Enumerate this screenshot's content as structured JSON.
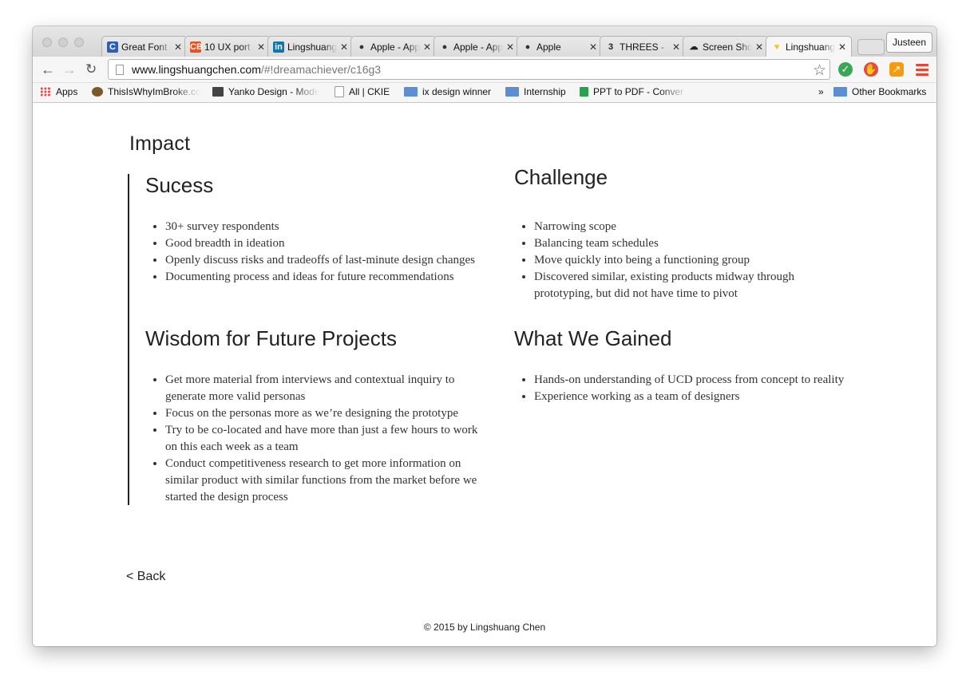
{
  "browser": {
    "tabs": [
      {
        "title": "Great Font",
        "icon": "c-logo-icon",
        "color": "#2f5fb5",
        "glyph": "C"
      },
      {
        "title": "10 UX port",
        "icon": "cb-logo-icon",
        "color": "#e55322",
        "glyph": "CB"
      },
      {
        "title": "Lingshuang",
        "icon": "linkedin-icon",
        "color": "#0e76a8",
        "glyph": "in"
      },
      {
        "title": "Apple - App",
        "icon": "apple-icon",
        "color": "#333333",
        "glyph": ""
      },
      {
        "title": "Apple - App",
        "icon": "apple-icon",
        "color": "#333333",
        "glyph": ""
      },
      {
        "title": "Apple",
        "icon": "apple-icon",
        "color": "#333333",
        "glyph": ""
      },
      {
        "title": "THREES - ",
        "icon": "threes-icon",
        "color": "#222222",
        "glyph": "3"
      },
      {
        "title": "Screen Sho",
        "icon": "cloud-icon",
        "color": "#222222",
        "glyph": "☁"
      },
      {
        "title": "Lingshuang",
        "icon": "heart-icon",
        "color": "#f5c518",
        "glyph": "♥",
        "active": true
      }
    ],
    "profile_name": "Justeen",
    "url_host": "www.lingshuangchen.com",
    "url_path": "/#!dreamachiever/c16g3",
    "bookmarks": [
      {
        "label": "Apps",
        "kind": "apps"
      },
      {
        "label": "ThisIsWhyImBroke.co",
        "kind": "page"
      },
      {
        "label": "Yanko Design - Mode",
        "kind": "page"
      },
      {
        "label": "All | CKIE",
        "kind": "doc"
      },
      {
        "label": "ix design winner",
        "kind": "folder"
      },
      {
        "label": "Internship",
        "kind": "folder"
      },
      {
        "label": "PPT to PDF - Conver",
        "kind": "page"
      }
    ],
    "overflow_label": "»",
    "other_bookmarks": "Other Bookmarks"
  },
  "page": {
    "heading": "Impact",
    "sections": {
      "success": {
        "title": "Sucess",
        "items": [
          "30+ survey respondents",
          "Good breadth in ideation",
          "Openly discuss risks and tradeoffs of last-minute design changes",
          "Documenting process and ideas for future recommendations"
        ]
      },
      "challenge": {
        "title": "Challenge",
        "items": [
          "Narrowing scope",
          "Balancing team schedules",
          "Move quickly into being a functioning group",
          "Discovered similar, existing products midway through prototyping, but did not have time to pivot"
        ]
      },
      "wisdom": {
        "title": "Wisdom for Future Projects",
        "items": [
          "Get more material from interviews and contextual inquiry to generate more valid personas",
          "Focus on the personas more as we’re designing the prototype",
          "Try to be co-located and have more than just a few hours to work on this each week as a team",
          "Conduct competitiveness research to get more information on similar product with similar functions from the market before we started the design process"
        ]
      },
      "gained": {
        "title": "What We Gained",
        "items": [
          "Hands-on understanding of UCD process from concept to reality",
          "Experience working as a team of designers"
        ]
      }
    },
    "back_label": "< Back",
    "footer": "© 2015 by Lingshuang Chen"
  }
}
